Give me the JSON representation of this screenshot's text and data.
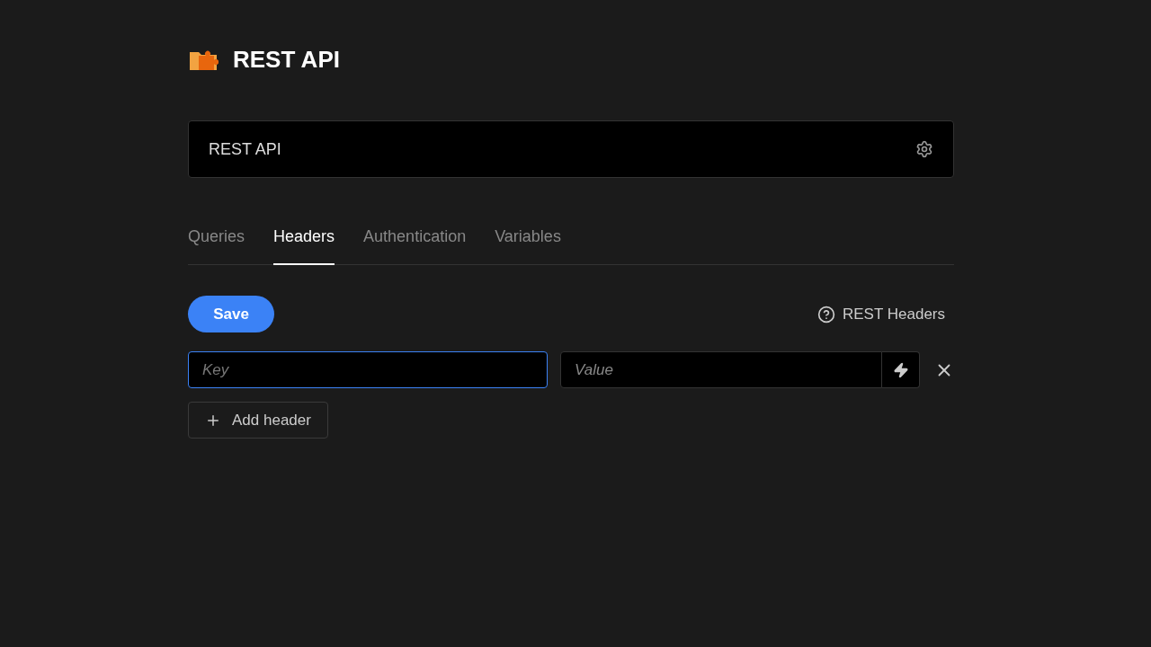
{
  "title": "REST API",
  "name_field": {
    "value": "REST API"
  },
  "tabs": [
    {
      "label": "Queries",
      "selected": false
    },
    {
      "label": "Headers",
      "selected": true
    },
    {
      "label": "Authentication",
      "selected": false
    },
    {
      "label": "Variables",
      "selected": false
    }
  ],
  "save_button": "Save",
  "help_link": "REST Headers",
  "headers": [
    {
      "key_placeholder": "Key",
      "value_placeholder": "Value",
      "key_focused": true
    }
  ],
  "add_button": "Add header"
}
